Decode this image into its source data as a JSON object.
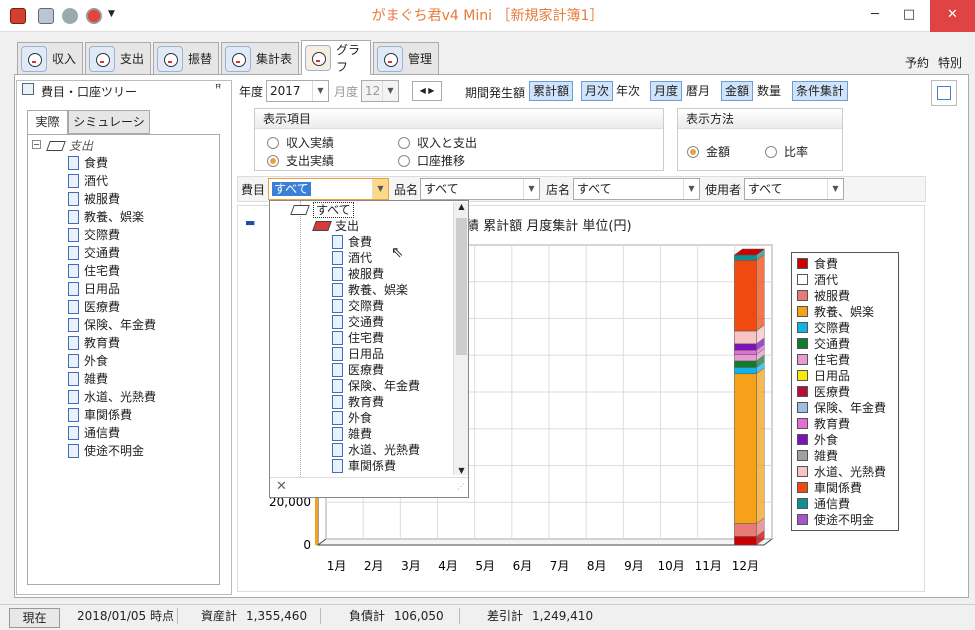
{
  "app": {
    "title": "がまぐち君v4 Mini ［新規家計簿1］"
  },
  "tabs": [
    {
      "label": "収入"
    },
    {
      "label": "支出"
    },
    {
      "label": "振替"
    },
    {
      "label": "集計表"
    },
    {
      "label": "グラフ"
    },
    {
      "label": "管理"
    }
  ],
  "header_links": {
    "reserve": "予約",
    "special": "特別"
  },
  "left_panel": {
    "title": "費目・口座ツリー",
    "tabs": [
      "実際",
      "シミュレーション"
    ],
    "root": "支出",
    "items": [
      "食費",
      "酒代",
      "被服費",
      "教養、娯楽",
      "交際費",
      "交通費",
      "住宅費",
      "日用品",
      "医療費",
      "保険、年金費",
      "教育費",
      "外食",
      "雑費",
      "水道、光熱費",
      "車関係費",
      "通信費",
      "使途不明金"
    ]
  },
  "toolbar": {
    "year_label": "年度",
    "year_value": "2017",
    "month_label": "月度",
    "month_value": "12",
    "period_label": "期間発生額",
    "cumulative": "累計額",
    "monthly": "月次",
    "yearly": "年次",
    "fiscal_month": "月度",
    "calendar_month": "暦月",
    "amount": "金額",
    "quantity": "数量",
    "condition": "条件集計"
  },
  "display_items": {
    "title": "表示項目",
    "options": [
      "収入実績",
      "収入と支出",
      "支出実績",
      "口座推移"
    ],
    "selected": "支出実績"
  },
  "display_method": {
    "title": "表示方法",
    "options": [
      "金額",
      "比率"
    ],
    "selected": "金額"
  },
  "filters": {
    "category_label": "費目",
    "category_value": "すべて",
    "product_label": "品名",
    "product_value": "すべて",
    "store_label": "店名",
    "store_value": "すべて",
    "user_label": "使用者",
    "user_value": "すべて"
  },
  "dropdown": {
    "all": "すべて",
    "root": "支出",
    "items": [
      "食費",
      "酒代",
      "被服費",
      "教養、娯楽",
      "交際費",
      "交通費",
      "住宅費",
      "日用品",
      "医療費",
      "保険、年金費",
      "教育費",
      "外食",
      "雑費",
      "水道、光熱費",
      "車関係費"
    ]
  },
  "chart_data": {
    "type": "bar",
    "stacked": true,
    "title": "績  累計額  月度集計  単位(円)",
    "categories": [
      "1月",
      "2月",
      "3月",
      "4月",
      "5月",
      "6月",
      "7月",
      "8月",
      "9月",
      "10月",
      "11月",
      "12月"
    ],
    "yticks": [
      "20,000",
      "0"
    ],
    "legend_position": "right",
    "series": [
      {
        "name": "食費",
        "color": "#cc0000",
        "values": [
          0,
          0,
          0,
          0,
          0,
          0,
          0,
          0,
          0,
          0,
          0,
          4000
        ]
      },
      {
        "name": "酒代",
        "color": "#ffffff",
        "values": [
          0,
          0,
          0,
          0,
          0,
          0,
          0,
          0,
          0,
          0,
          0,
          0
        ]
      },
      {
        "name": "被服費",
        "color": "#e87a78",
        "values": [
          0,
          0,
          0,
          0,
          0,
          0,
          0,
          0,
          0,
          0,
          0,
          6000
        ]
      },
      {
        "name": "教養、娯楽",
        "color": "#f5a21a",
        "values": [
          0,
          0,
          0,
          0,
          0,
          0,
          0,
          0,
          0,
          0,
          0,
          70000
        ]
      },
      {
        "name": "交際費",
        "color": "#12b2e6",
        "values": [
          0,
          0,
          0,
          0,
          0,
          0,
          0,
          0,
          0,
          0,
          0,
          3000
        ]
      },
      {
        "name": "交通費",
        "color": "#0f7b2c",
        "values": [
          0,
          0,
          0,
          0,
          0,
          0,
          0,
          0,
          0,
          0,
          0,
          3000
        ]
      },
      {
        "name": "住宅費",
        "color": "#e89ad2",
        "values": [
          0,
          0,
          0,
          0,
          0,
          0,
          0,
          0,
          0,
          0,
          0,
          3000
        ]
      },
      {
        "name": "日用品",
        "color": "#f5e80a",
        "values": [
          0,
          0,
          0,
          0,
          0,
          0,
          0,
          0,
          0,
          0,
          0,
          0
        ]
      },
      {
        "name": "医療費",
        "color": "#b80f3a",
        "values": [
          0,
          0,
          0,
          0,
          0,
          0,
          0,
          0,
          0,
          0,
          0,
          0
        ]
      },
      {
        "name": "保険、年金費",
        "color": "#9fbde0",
        "values": [
          0,
          0,
          0,
          0,
          0,
          0,
          0,
          0,
          0,
          0,
          0,
          0
        ]
      },
      {
        "name": "教育費",
        "color": "#e36fd6",
        "values": [
          0,
          0,
          0,
          0,
          0,
          0,
          0,
          0,
          0,
          0,
          0,
          2000
        ]
      },
      {
        "name": "外食",
        "color": "#7a14b8",
        "values": [
          0,
          0,
          0,
          0,
          0,
          0,
          0,
          0,
          0,
          0,
          0,
          3000
        ]
      },
      {
        "name": "雑費",
        "color": "#a0a0a0",
        "values": [
          0,
          0,
          0,
          0,
          0,
          0,
          0,
          0,
          0,
          0,
          0,
          0
        ]
      },
      {
        "name": "水道、光熱費",
        "color": "#f7c3c3",
        "values": [
          0,
          0,
          0,
          0,
          0,
          0,
          0,
          0,
          0,
          0,
          0,
          6000
        ]
      },
      {
        "name": "車関係費",
        "color": "#f04a10",
        "values": [
          0,
          0,
          0,
          0,
          0,
          0,
          0,
          0,
          0,
          0,
          0,
          33000
        ]
      },
      {
        "name": "通信費",
        "color": "#0f8f92",
        "values": [
          0,
          0,
          0,
          0,
          0,
          0,
          0,
          0,
          0,
          0,
          0,
          2500
        ]
      },
      {
        "name": "使途不明金",
        "color": "#a754c7",
        "values": [
          0,
          0,
          0,
          0,
          0,
          0,
          0,
          0,
          0,
          0,
          0,
          0
        ]
      }
    ]
  },
  "status": {
    "now_button": "現在",
    "date": "2018/01/05 時点",
    "assets_label": "資産計",
    "assets": "1,355,460",
    "liabilities_label": "負債計",
    "liabilities": "106,050",
    "diff_label": "差引計",
    "diff": "1,249,410"
  }
}
